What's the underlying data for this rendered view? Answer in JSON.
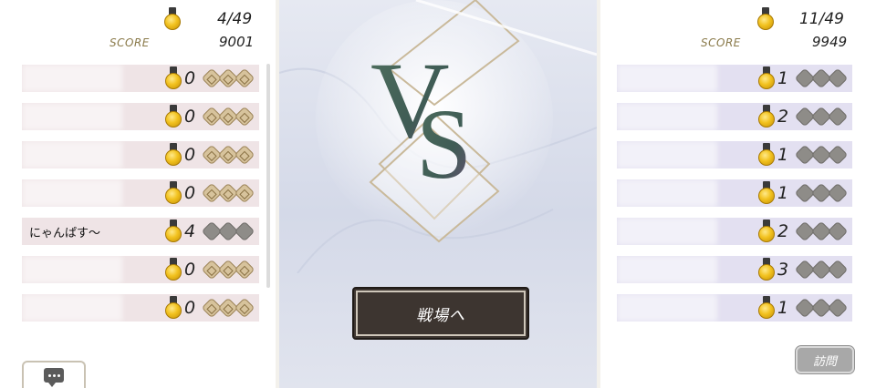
{
  "left_player": {
    "count": "4/49",
    "score_label": "SCORE",
    "score": "9001",
    "rows": [
      {
        "name": "",
        "blurred": true,
        "medals": "0",
        "token_color": "bronze"
      },
      {
        "name": "",
        "blurred": true,
        "medals": "0",
        "token_color": "bronze"
      },
      {
        "name": "",
        "blurred": true,
        "medals": "0",
        "token_color": "bronze"
      },
      {
        "name": "",
        "blurred": true,
        "medals": "0",
        "token_color": "bronze"
      },
      {
        "name": "にゃんぱす～",
        "blurred": false,
        "medals": "4",
        "token_color": "grey"
      },
      {
        "name": "",
        "blurred": true,
        "medals": "0",
        "token_color": "bronze"
      },
      {
        "name": "",
        "blurred": true,
        "medals": "0",
        "token_color": "bronze"
      }
    ]
  },
  "right_player": {
    "count": "11/49",
    "score_label": "SCORE",
    "score": "9949",
    "rows": [
      {
        "name": "",
        "blurred": true,
        "medals": "1",
        "token_color": "grey"
      },
      {
        "name": "",
        "blurred": true,
        "medals": "2",
        "token_color": "grey"
      },
      {
        "name": "",
        "blurred": true,
        "medals": "1",
        "token_color": "grey"
      },
      {
        "name": "",
        "blurred": true,
        "medals": "1",
        "token_color": "grey"
      },
      {
        "name": "",
        "blurred": true,
        "medals": "2",
        "token_color": "grey"
      },
      {
        "name": "",
        "blurred": true,
        "medals": "3",
        "token_color": "grey"
      },
      {
        "name": "",
        "blurred": true,
        "medals": "1",
        "token_color": "grey"
      }
    ]
  },
  "center": {
    "vs_text": "VS",
    "battle_label": "戦場へ"
  },
  "visit_label": "訪問",
  "icons": {
    "medal": "medal-icon",
    "chat": "chat-icon",
    "token": "token-icon"
  },
  "colors": {
    "left_row": "#efe4e6",
    "right_row": "#e3e0f1",
    "button_dark": "#3d3530"
  }
}
